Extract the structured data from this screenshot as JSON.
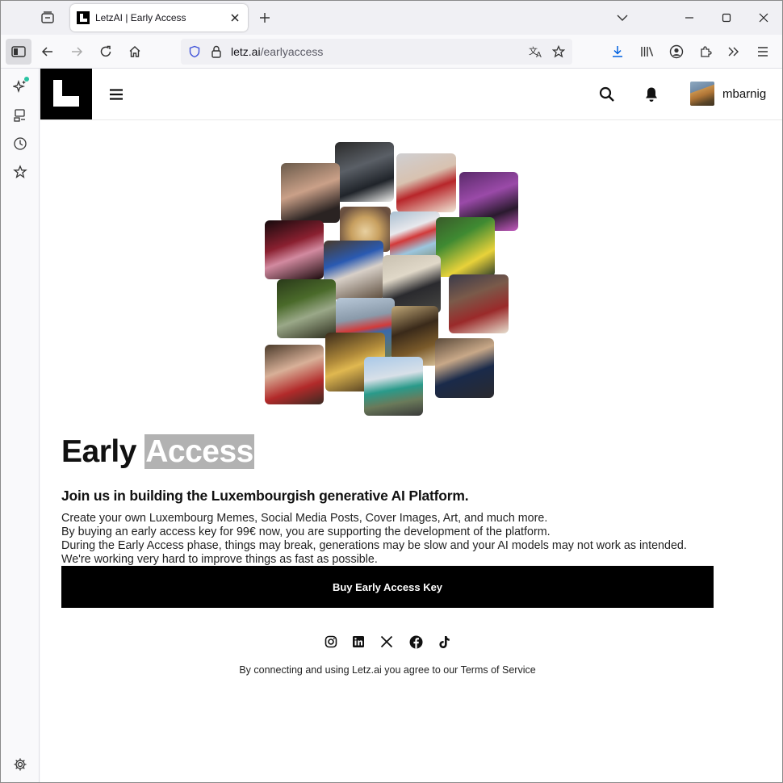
{
  "browser": {
    "tab": {
      "title": "LetzAI | Early Access",
      "favicon": "letzai-logo-icon"
    },
    "url": {
      "host": "letz.ai",
      "path": "/earlyaccess"
    },
    "icons": [
      "tab-overview-icon",
      "close-icon",
      "plus-icon",
      "chevron-down-icon",
      "minimize-icon",
      "maximize-icon",
      "close-window-icon",
      "sidebar-toggle-icon",
      "back-icon",
      "forward-icon",
      "reload-icon",
      "home-icon",
      "shield-icon",
      "lock-icon",
      "translate-icon",
      "star-icon",
      "download-icon",
      "library-icon",
      "account-icon",
      "extensions-icon",
      "overflow-icon",
      "menu-icon"
    ]
  },
  "sidebar": {
    "items": [
      "ai-chatbot-icon",
      "synced-tabs-icon",
      "history-icon",
      "bookmarks-icon",
      "settings-icon"
    ],
    "accent": "#2ac3a2"
  },
  "site": {
    "username": "mbarnig",
    "headline_plain": "Early",
    "headline_highlight": "Access",
    "subheadline": "Join us in building the Luxembourgish generative AI Platform.",
    "paragraph_lines": [
      "Create your own Luxembourg Memes, Social Media Posts, Cover Images, Art, and much more.",
      "By buying an early access key for 99€ now, you are supporting the development of the platform.",
      "During the Early Access phase, things may break, generations may be slow and your AI models may not work as intended.",
      "We're working very hard to improve things as fast as possible."
    ],
    "cta_label": "Buy Early Access Key",
    "social": [
      "instagram-icon",
      "linkedin-icon",
      "x-icon",
      "facebook-icon",
      "tiktok-icon"
    ],
    "tos_text": "By connecting and using Letz.ai you agree to our Terms of Service"
  },
  "colors": {
    "cta_bg": "#000000",
    "highlight_bg": "#b2b2b2"
  }
}
